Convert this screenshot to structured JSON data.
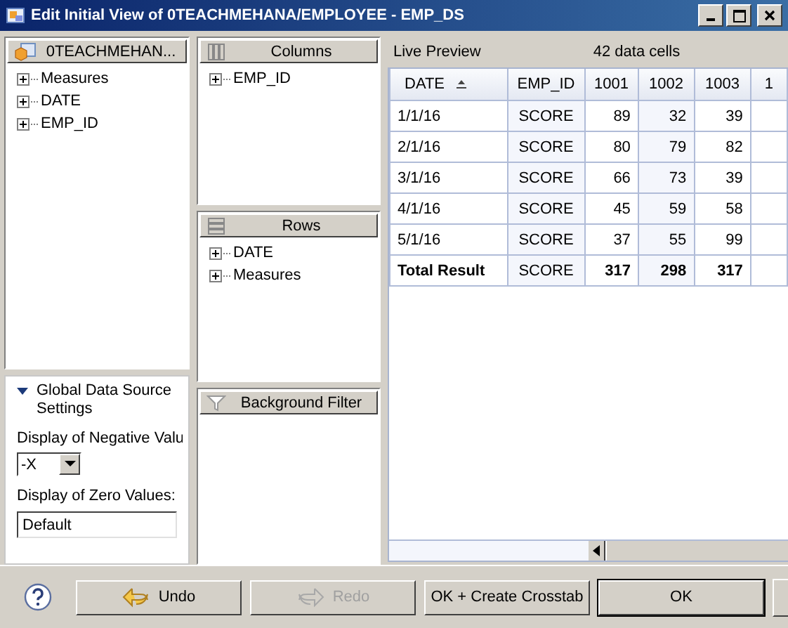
{
  "window": {
    "title": "Edit Initial View of 0TEACHMEHANA/EMPLOYEE - EMP_DS"
  },
  "source_panel": {
    "title": "0TEACHMEHAN...",
    "items": [
      {
        "label": "Measures",
        "expanded": false
      },
      {
        "label": "DATE",
        "expanded": false
      },
      {
        "label": "EMP_ID",
        "expanded": false
      }
    ]
  },
  "settings": {
    "title": "Global Data Source Settings",
    "expanded": true,
    "negative_label": "Display of Negative Valu",
    "negative_value": "-X",
    "zero_label": "Display of Zero Values:",
    "zero_value": "Default"
  },
  "columns_panel": {
    "title": "Columns",
    "items": [
      {
        "label": "EMP_ID",
        "expanded": false
      }
    ]
  },
  "rows_panel": {
    "title": "Rows",
    "items": [
      {
        "label": "DATE",
        "expanded": false
      },
      {
        "label": "Measures",
        "expanded": false
      }
    ]
  },
  "filter_panel": {
    "title": "Background Filter"
  },
  "preview": {
    "title": "Live Preview",
    "cell_count": "42 data cells",
    "columns": [
      {
        "label": "DATE",
        "sorted": true
      },
      {
        "label": "EMP_ID",
        "sorted": false
      },
      {
        "label": "1001",
        "sorted": false
      },
      {
        "label": "1002",
        "sorted": false
      },
      {
        "label": "1003",
        "sorted": false
      },
      {
        "label": "1",
        "sorted": false
      }
    ],
    "rows": [
      {
        "total": false,
        "cells": [
          "1/1/16",
          "SCORE",
          "89",
          "32",
          "39"
        ]
      },
      {
        "total": false,
        "cells": [
          "2/1/16",
          "SCORE",
          "80",
          "79",
          "82"
        ]
      },
      {
        "total": false,
        "cells": [
          "3/1/16",
          "SCORE",
          "66",
          "73",
          "39"
        ]
      },
      {
        "total": false,
        "cells": [
          "4/1/16",
          "SCORE",
          "45",
          "59",
          "58"
        ]
      },
      {
        "total": false,
        "cells": [
          "5/1/16",
          "SCORE",
          "37",
          "55",
          "99"
        ]
      },
      {
        "total": true,
        "cells": [
          "Total Result",
          "SCORE",
          "317",
          "298",
          "317"
        ]
      }
    ]
  },
  "buttons": [
    {
      "kind": "undo",
      "label": "Undo",
      "disabled": false,
      "default": false
    },
    {
      "kind": "redo",
      "label": "Redo",
      "disabled": true,
      "default": false
    },
    {
      "kind": "plain",
      "label": "OK + Create Crosstab",
      "disabled": false,
      "default": false
    },
    {
      "kind": "plain",
      "label": "OK",
      "disabled": false,
      "default": true
    }
  ]
}
